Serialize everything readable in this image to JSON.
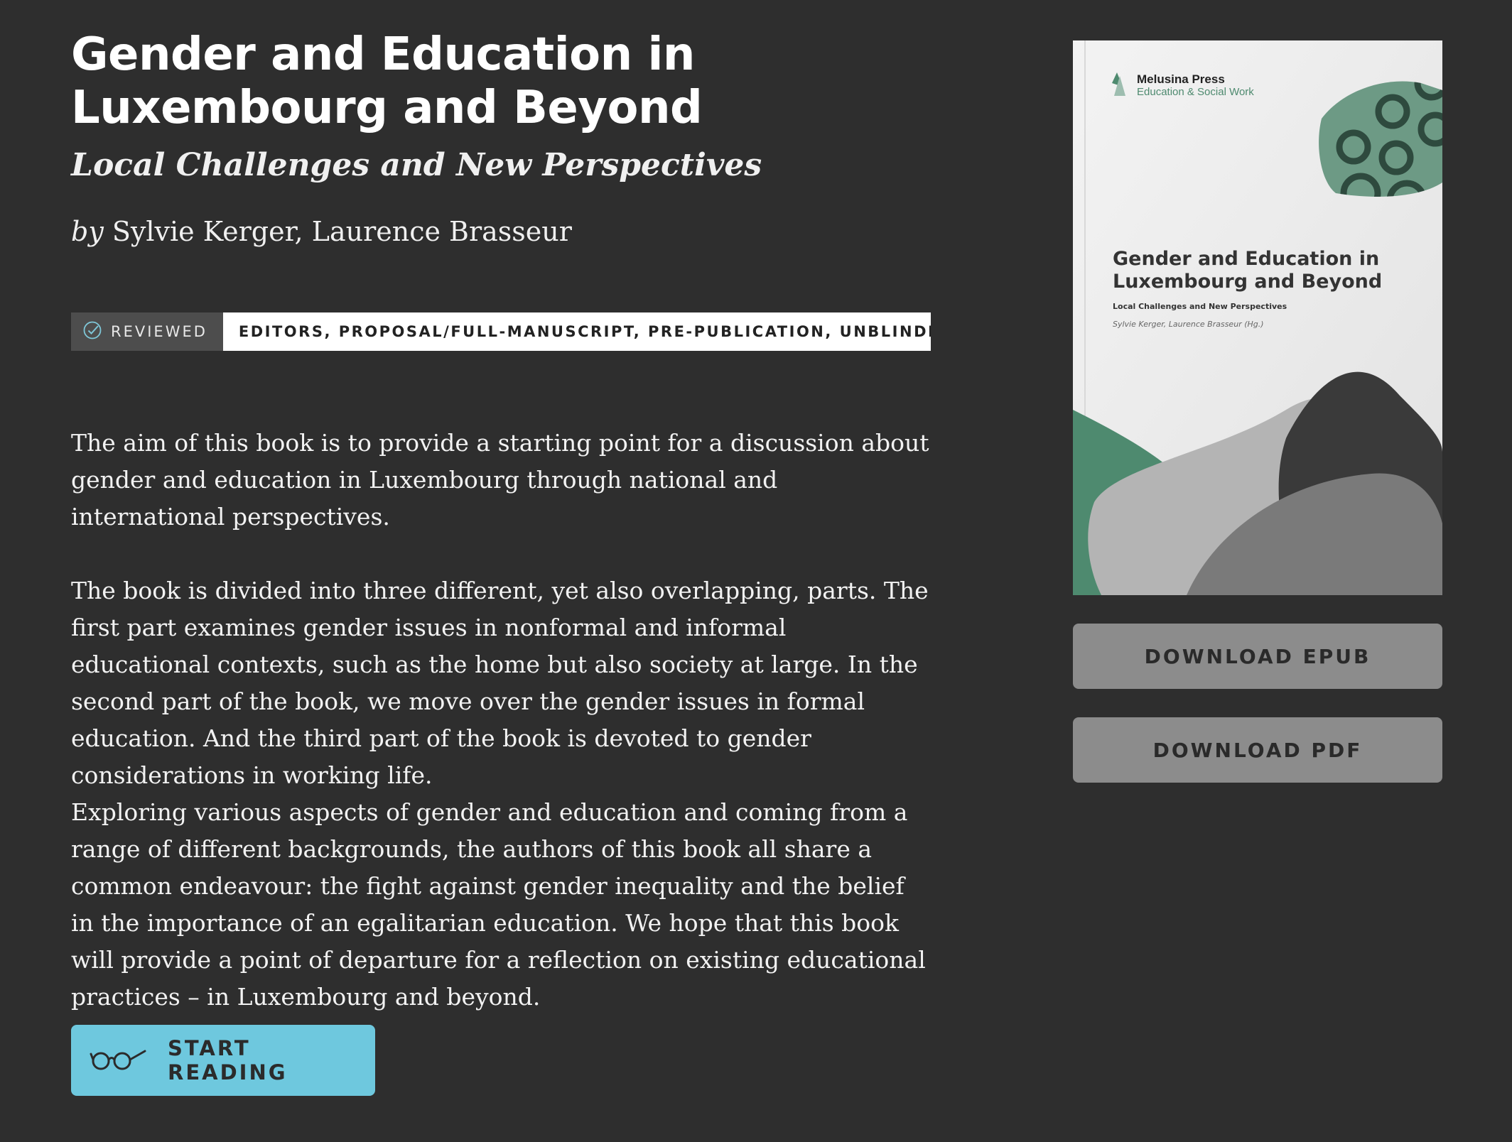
{
  "book": {
    "title": "Gender and Education in Luxembourg and Beyond",
    "subtitle": "Local Challenges and New Perspectives",
    "by_prefix": "by",
    "authors": "Sylvie Kerger, Laurence Brasseur"
  },
  "review": {
    "label": "REVIEWED",
    "details": "EDITORS, PROPOSAL/FULL-MANUSCRIPT, PRE-PUBLICATION, UNBLINDED",
    "icon": "check-circle-icon"
  },
  "description": {
    "p1": "The aim of this book is to provide a starting point for a discussion about gen­der and education in Luxembourg through national and international per­spectives.",
    "p2": "The book is divided into three different, yet also overlapping, parts. The first part examines gender issues in nonformal and informal educational contexts, such as the home but also society at large. In the second part of the book, we move over the gender issues in formal education. And the third part of the book is devoted to gender considerations in working life.",
    "p3": "Exploring various aspects of gender and education and coming from a range of different backgrounds, the authors of this book all share a common en­deavour: the fight against gender inequality and the belief in the importance of an egalitarian education. We hope that this book will provide a point of de­parture for a reflection on existing educational practices – in Luxembourg and beyond."
  },
  "start_reading": {
    "label": "START READING",
    "icon": "glasses-icon"
  },
  "cover": {
    "publisher": "Melusina Press",
    "series": "Education & Social Work",
    "title_line1": "Gender and Education in",
    "title_line2": "Luxembourg and Beyond",
    "subtitle": "Local Challenges and New Perspectives",
    "authors": "Sylvie Kerger, Laurence Brasseur (Hg.)"
  },
  "downloads": {
    "epub_label": "DOWNLOAD EPUB",
    "pdf_label": "DOWNLOAD PDF"
  },
  "colors": {
    "background": "#2e2e2e",
    "accent": "#6ec8de",
    "cover_green": "#4e8a6f",
    "download_button": "#8c8c8c"
  }
}
